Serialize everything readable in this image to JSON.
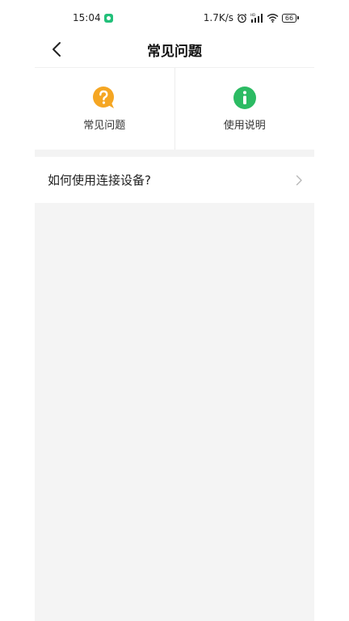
{
  "status_bar": {
    "time": "15:04",
    "network_speed": "1.7K/s",
    "battery_level": "66",
    "icons": [
      "app-notification-icon",
      "alarm-icon",
      "hd-signal-icon",
      "wifi-icon",
      "battery-icon"
    ]
  },
  "header": {
    "title": "常见问题",
    "back_icon": "chevron-left-icon"
  },
  "tabs": [
    {
      "label": "常见问题",
      "icon": "question-bubble-icon",
      "color": "#f5a623"
    },
    {
      "label": "使用说明",
      "icon": "info-circle-icon",
      "color": "#2cbb63"
    }
  ],
  "faq_items": [
    {
      "question": "如何使用连接设备?"
    }
  ],
  "colors": {
    "content_background": "#f4f4f4",
    "chevron": "#b5b5b5"
  }
}
